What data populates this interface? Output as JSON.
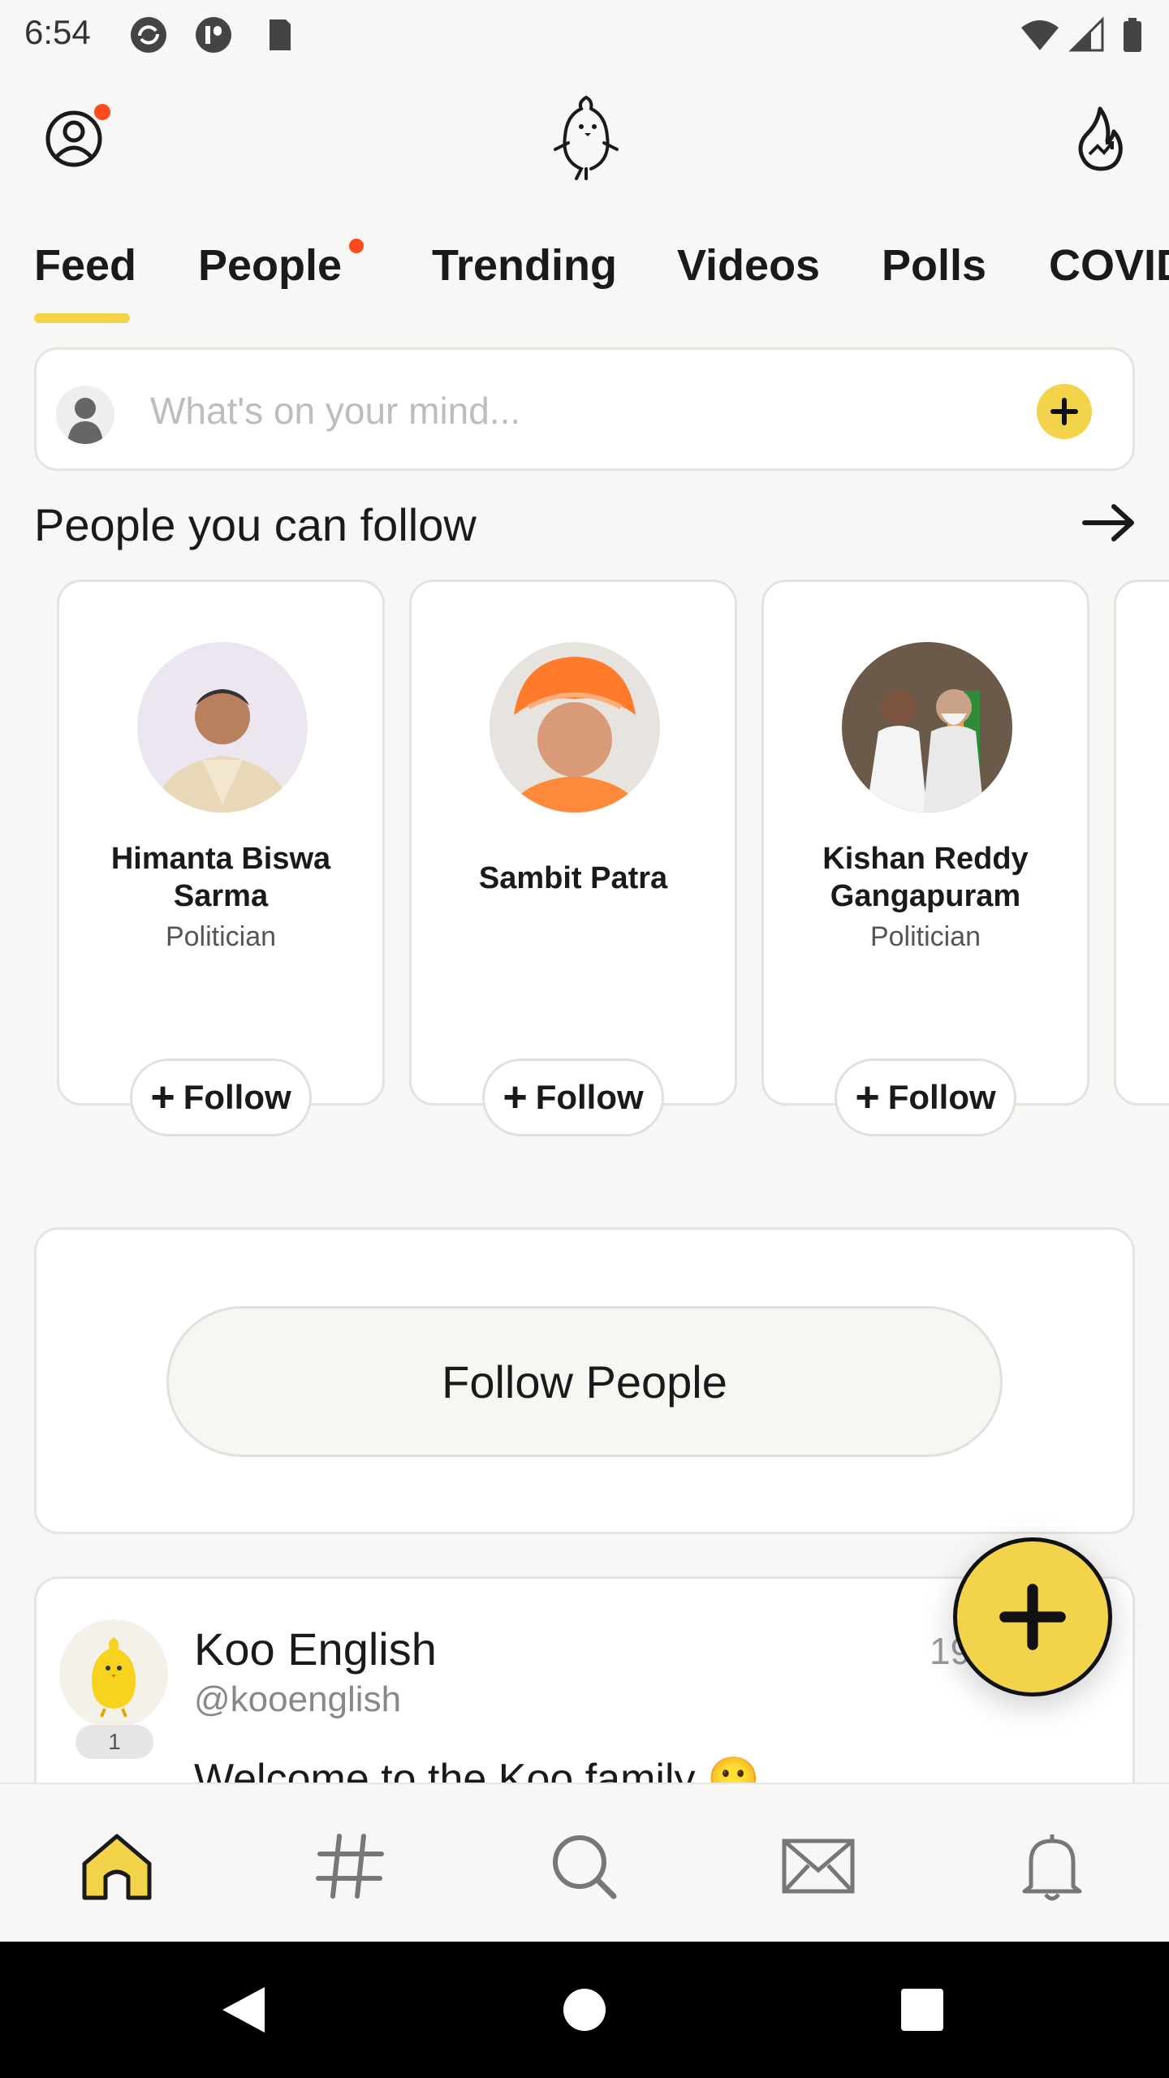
{
  "status_bar": {
    "time": "6:54"
  },
  "tabs": [
    {
      "label": "Feed",
      "active": true
    },
    {
      "label": "People",
      "dot": true
    },
    {
      "label": "Trending"
    },
    {
      "label": "Videos"
    },
    {
      "label": "Polls"
    },
    {
      "label": "COVID"
    }
  ],
  "composer": {
    "placeholder": "What's on your mind..."
  },
  "suggestions": {
    "title": "People you can follow",
    "cards": [
      {
        "name": "Himanta Biswa Sarma",
        "role": "Politician",
        "follow_label": "Follow"
      },
      {
        "name": "Sambit Patra",
        "role": "",
        "follow_label": "Follow"
      },
      {
        "name": "Kishan Reddy Gangapuram",
        "role": "Politician",
        "follow_label": "Follow"
      }
    ]
  },
  "follow_people": {
    "label": "Follow People"
  },
  "post": {
    "author": "Koo English",
    "handle": "@kooenglish",
    "badge": "1",
    "time": "19",
    "text": "Welcome to the Koo family 🙂"
  },
  "colors": {
    "accent": "#f3d34a",
    "notification_dot": "#ff4a1c"
  },
  "icons": {
    "header_left": "profile-icon",
    "header_center": "koo-bird-logo",
    "header_right": "trending-flame-icon",
    "bottom_nav": [
      "home-icon",
      "hashtag-icon",
      "search-icon",
      "mail-icon",
      "bell-icon"
    ]
  }
}
